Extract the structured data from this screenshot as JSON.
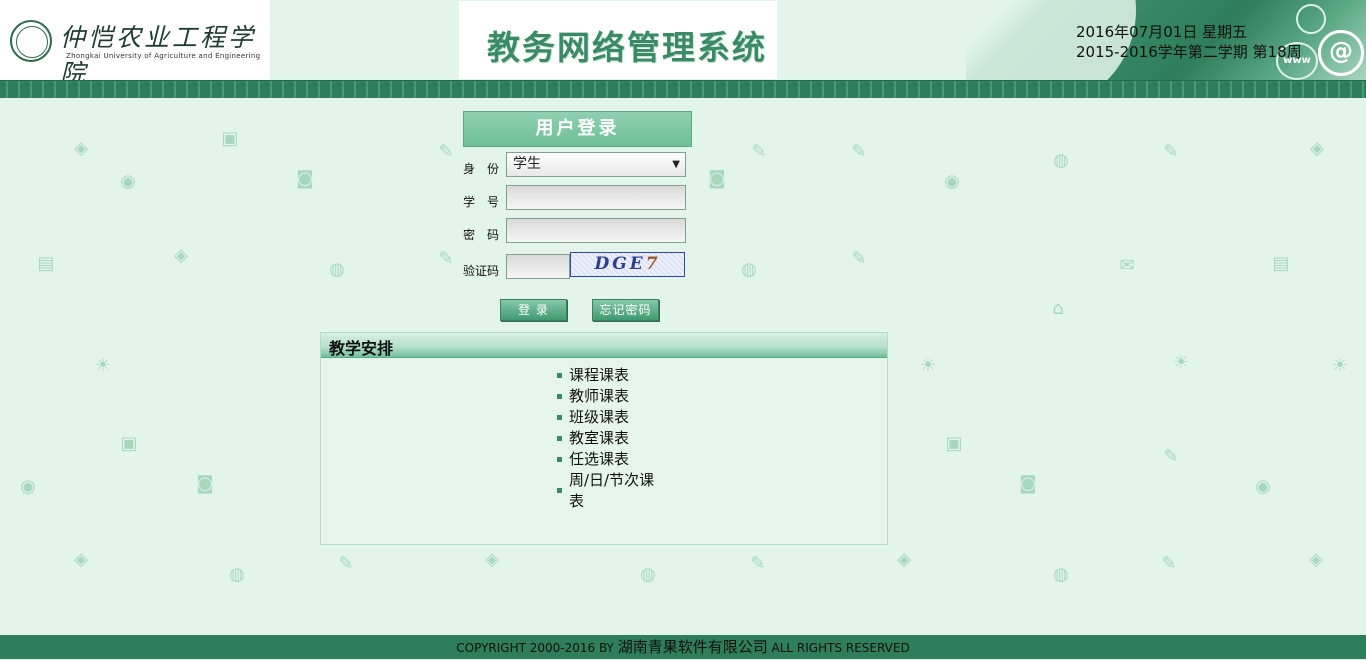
{
  "header": {
    "school_name_cn": "仲恺农业工程学院",
    "school_name_en": "Zhongkai University of Agriculture and Engineering",
    "system_title": "教务网络管理系统",
    "date_line": "2016年07月01日 星期五",
    "term_line": "2015-2016学年第二学期 第18周",
    "banner_glyphs": {
      "at": "@",
      "www": "www"
    }
  },
  "login": {
    "title": "用户登录",
    "role_label": "身　份",
    "role_value": "学生",
    "student_id_label": "学　号",
    "student_id_value": "",
    "password_label": "密　码",
    "password_value": "",
    "captcha_label": "验证码",
    "captcha_value": "",
    "captcha_text": "DGE",
    "captcha_text_last": "7",
    "login_button": "登 录",
    "forgot_button": "忘记密码"
  },
  "arrangement": {
    "title": "教学安排",
    "items": [
      "课程课表",
      "教师课表",
      "班级课表",
      "教室课表",
      "任选课表",
      "周/日/节次课表"
    ]
  },
  "footer": {
    "prefix": "COPYRIGHT 2000-2016 BY ",
    "company": "湖南青果软件有限公司",
    "suffix": " ALL RIGHTS RESERVED"
  },
  "colors": {
    "background": "#e3f4ea",
    "accent": "#2e7d5b",
    "button": "#3f9a70"
  },
  "icons": [
    "school-seal-icon",
    "dropdown-arrow-icon",
    "background-pattern-icons"
  ]
}
